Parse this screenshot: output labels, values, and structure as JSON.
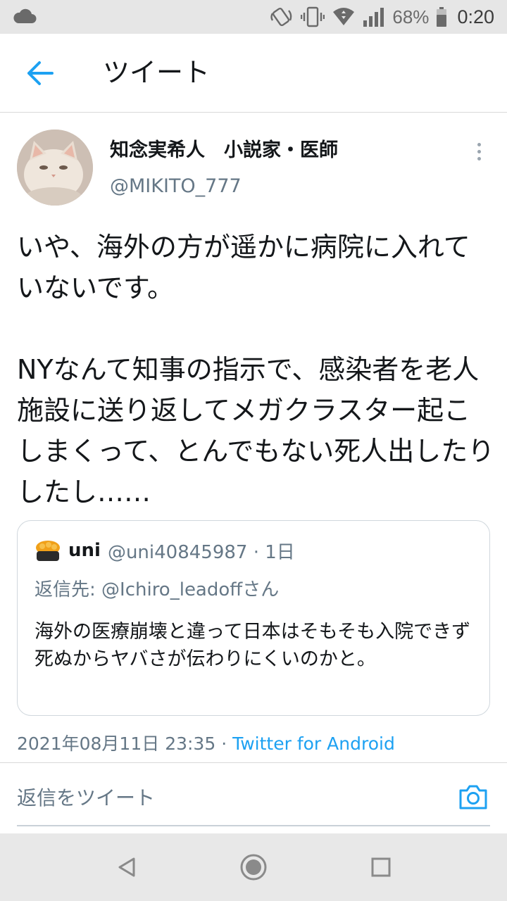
{
  "status_bar": {
    "battery": "68%",
    "time": "0:20",
    "icons": [
      "cloud-icon",
      "nfc-icon",
      "vibrate-icon",
      "wifi-icon",
      "signal-icon",
      "battery-icon"
    ]
  },
  "app_bar": {
    "title": "ツイート",
    "back_icon": "arrow-left-icon",
    "accent_color": "#1da1f2"
  },
  "tweet": {
    "author_name": "知念実希人　小説家・医師",
    "author_handle": "@MIKITO_777",
    "paragraph_1": "いや、海外の方が遥かに病院に入れていないです。",
    "paragraph_2": "NYなんて知事の指示で、感染者を老人施設に送り返してメガクラスター起こしまくって、とんでもない死人出したりしたし……",
    "timestamp": "2021年08月11日 23:35",
    "separator": " · ",
    "source": "Twitter for Android"
  },
  "quoted_tweet": {
    "name": "uni",
    "handle_time": "@uni40845987 · 1日",
    "reply_to": "返信先: @Ichiro_leadoffさん",
    "text": "海外の医療崩壊と違って日本はそもそも入院できず死ぬからヤバさが伝わりにくいのかと。"
  },
  "reply_bar": {
    "placeholder": "返信をツイート",
    "camera_icon": "camera-icon"
  },
  "nav_bar": {
    "icons": [
      "back-triangle-icon",
      "home-circle-icon",
      "recents-square-icon"
    ]
  }
}
